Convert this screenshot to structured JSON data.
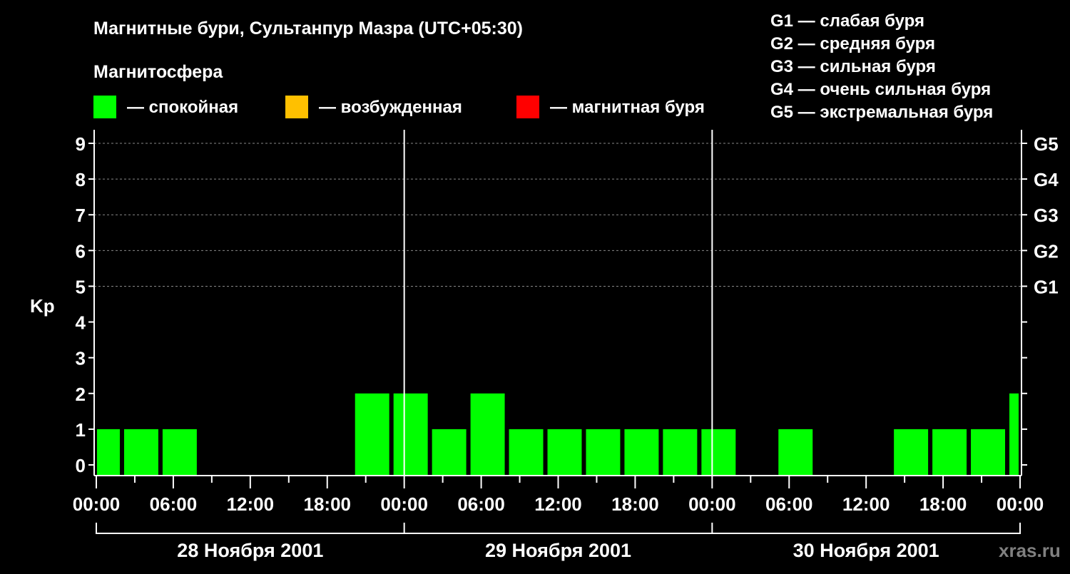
{
  "chart_data": {
    "type": "bar",
    "title": "Магнитные бури, Сультанпур Мазра (UTC+05:30)",
    "subtitle": "Магнитосфера",
    "ylabel": "Kp",
    "ylim": [
      0,
      9
    ],
    "yticks": [
      "0",
      "1",
      "2",
      "3",
      "4",
      "5",
      "6",
      "7",
      "8",
      "9"
    ],
    "right_ticks": [
      {
        "kp": 5,
        "label": "G1"
      },
      {
        "kp": 6,
        "label": "G2"
      },
      {
        "kp": 7,
        "label": "G3"
      },
      {
        "kp": 8,
        "label": "G4"
      },
      {
        "kp": 9,
        "label": "G5"
      }
    ],
    "legend": [
      {
        "label": "— спокойная",
        "color": "#00ff00"
      },
      {
        "label": "— возбужденная",
        "color": "#ffc000"
      },
      {
        "label": "— магнитная буря",
        "color": "#ff0000"
      }
    ],
    "g_legend": [
      "G1 — слабая буря",
      "G2 — средняя буря",
      "G3 — сильная буря",
      "G4 — очень сильная буря",
      "G5 — экстремальная буря"
    ],
    "xticks": [
      "00:00",
      "06:00",
      "12:00",
      "18:00",
      "00:00",
      "06:00",
      "12:00",
      "18:00",
      "00:00",
      "06:00",
      "12:00",
      "18:00",
      "00:00"
    ],
    "days": [
      "28 Ноября 2001",
      "29 Ноября 2001",
      "30 Ноября 2001"
    ],
    "x_range_hours": [
      0,
      72
    ],
    "bar_duration_hours": 3,
    "bar_start_hours": [
      -1,
      2,
      5,
      8,
      11,
      14,
      17,
      20,
      23,
      26,
      29,
      32,
      35,
      38,
      41,
      44,
      47,
      50,
      53,
      56,
      59,
      62,
      65,
      68,
      71
    ],
    "values": [
      1,
      1,
      1,
      0,
      0,
      0,
      0,
      2,
      2,
      1,
      2,
      1,
      1,
      1,
      1,
      1,
      1,
      0,
      1,
      0,
      0,
      1,
      1,
      1,
      2
    ]
  },
  "watermark": "xras.ru"
}
